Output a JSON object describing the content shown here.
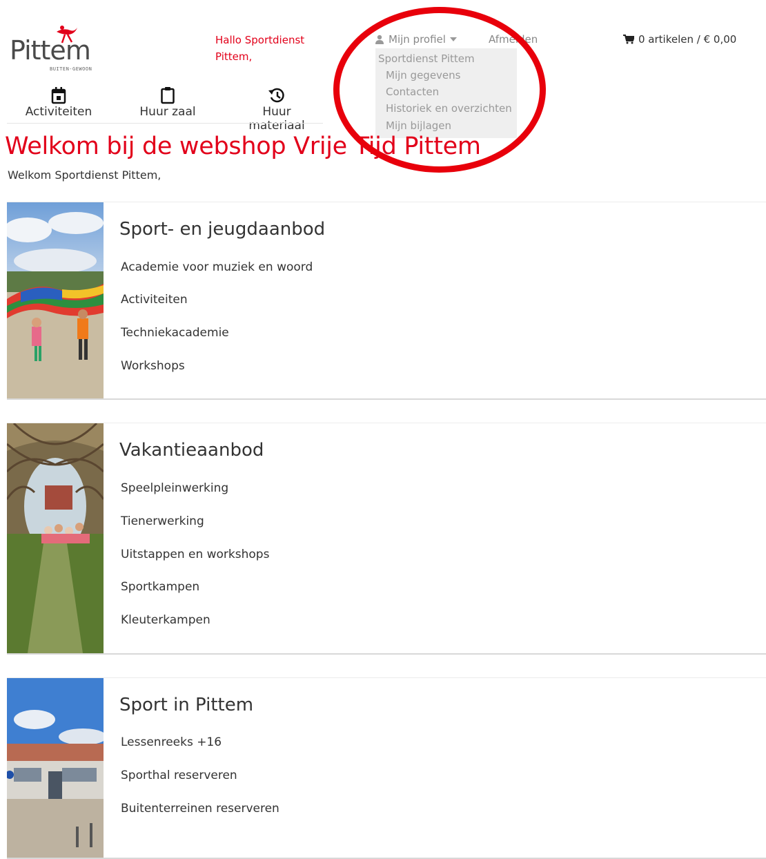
{
  "header": {
    "logo_text": "Pittem",
    "logo_subtext": "BUITEN-GEWOON",
    "greeting": "Hallo Sportdienst Pittem,",
    "profile_label": "Mijn profiel",
    "logout_label": "Afmelden",
    "cart_label": "0 artikelen / € 0,00"
  },
  "profile_menu": {
    "account_name": "Sportdienst Pittem",
    "items": [
      {
        "label": "Mijn gegevens"
      },
      {
        "label": "Contacten"
      },
      {
        "label": "Historiek en overzichten"
      },
      {
        "label": "Mijn bijlagen"
      }
    ]
  },
  "nav": {
    "items": [
      {
        "label": "Activiteiten",
        "icon": "calendar-icon"
      },
      {
        "label": "Huur zaal",
        "icon": "clipboard-icon"
      },
      {
        "label": "Huur materiaal",
        "icon": "history-icon"
      }
    ]
  },
  "page": {
    "title": "Welkom bij de webshop Vrije Tijd Pittem",
    "welcome": "Welkom Sportdienst Pittem,"
  },
  "categories": [
    {
      "title": "Sport- en jeugdaanbod",
      "links": [
        "Academie voor muziek en woord",
        "Activiteiten",
        "Techniekacademie",
        "Workshops"
      ]
    },
    {
      "title": "Vakantieaanbod",
      "links": [
        "Speelpleinwerking",
        "Tienerwerking",
        "Uitstappen en workshops",
        "Sportkampen",
        "Kleuterkampen"
      ]
    },
    {
      "title": "Sport in Pittem",
      "links": [
        "Lessenreeks +16",
        "Sporthal reserveren",
        "Buitenterreinen reserveren"
      ]
    }
  ],
  "colors": {
    "accent": "#e2001a",
    "annotation": "#e8000b",
    "dropdown_bg": "#efefef"
  }
}
